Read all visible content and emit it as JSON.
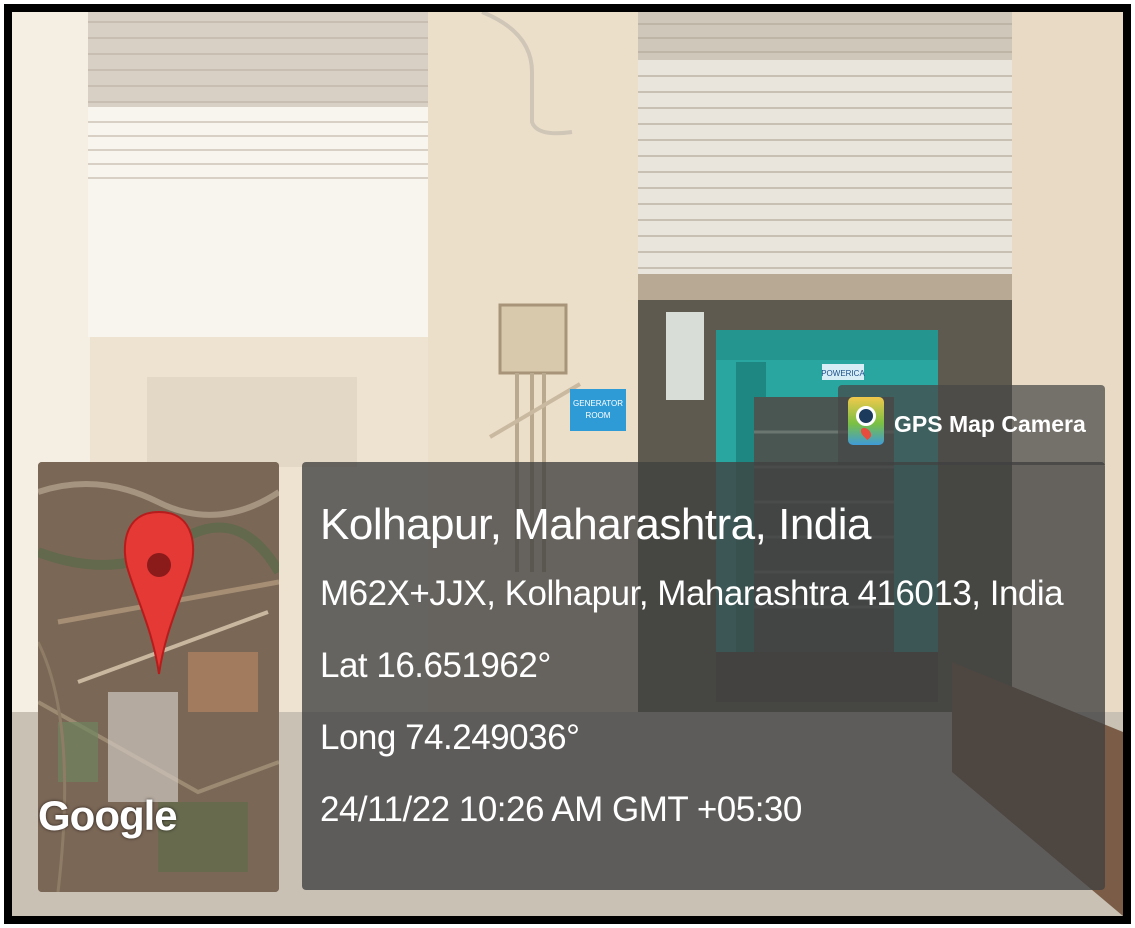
{
  "photo": {
    "sign_text_line1": "GENERATOR",
    "sign_text_line2": "ROOM",
    "brand_text": "POWERICA"
  },
  "gps_badge": {
    "app_name": "GPS Map Camera",
    "icon": "gps-map-camera-icon"
  },
  "location": {
    "title": "Kolhapur, Maharashtra, India",
    "address": "M62X+JJX, Kolhapur, Maharashtra 416013, India",
    "latitude": "Lat 16.651962°",
    "longitude": "Long 74.249036°",
    "datetime": "24/11/22 10:26 AM GMT +05:30"
  },
  "map": {
    "provider_logo": "Google",
    "marker_icon": "map-pin-icon",
    "marker_color": "#e53935"
  },
  "colors": {
    "panel_bg": "#404040",
    "text": "#ffffff",
    "generator_body": "#2aa6a0"
  }
}
